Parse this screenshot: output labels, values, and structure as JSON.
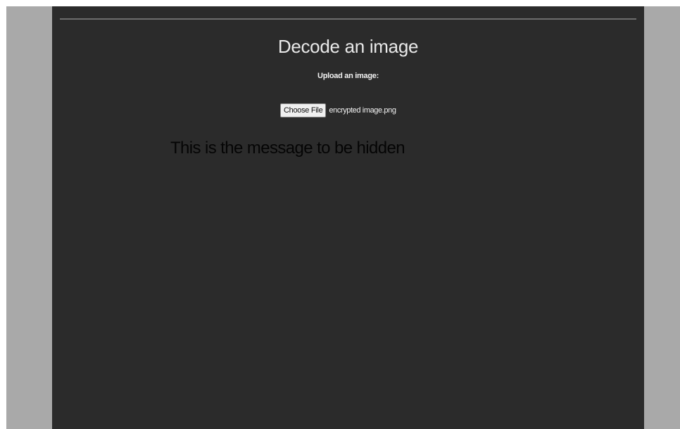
{
  "page": {
    "title": "Decode an image",
    "upload_label": "Upload an image:",
    "file_input": {
      "button_label": "Choose File",
      "selected_file": "encrypted image.png"
    },
    "decoded_message": "This is the message to be hidden"
  },
  "colors": {
    "panel_background": "#2b2b2b",
    "page_background": "#a9a9a9",
    "divider": "#6d6d6d",
    "title_text": "#e9e9e9",
    "message_text": "#050505"
  }
}
